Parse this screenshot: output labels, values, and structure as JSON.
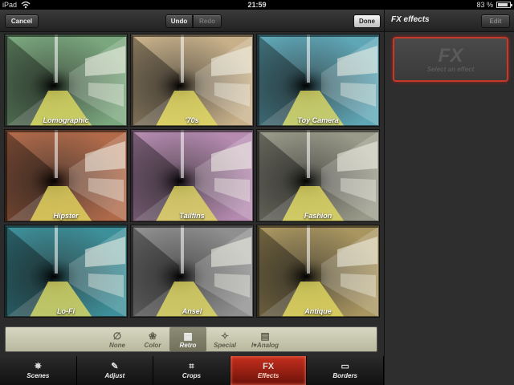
{
  "status_bar": {
    "device": "iPad",
    "time": "21:59",
    "battery_label": "83 %",
    "battery_level": 0.83,
    "wifi_icon": "wifi-icon"
  },
  "toolbar": {
    "cancel_label": "Cancel",
    "undo_label": "Undo",
    "redo_label": "Redo",
    "done_label": "Done"
  },
  "effects": [
    {
      "label": "Lomographic",
      "tint": "#7aa77d"
    },
    {
      "label": "'70s",
      "tint": "#c8b18a"
    },
    {
      "label": "Toy Camera",
      "tint": "#5fa6b6"
    },
    {
      "label": "Hipster",
      "tint": "#b06a4a"
    },
    {
      "label": "Tailfins",
      "tint": "#b58bb0"
    },
    {
      "label": "Fashion",
      "tint": "#9a9a8a"
    },
    {
      "label": "Lo-Fi",
      "tint": "#3d8f99"
    },
    {
      "label": "Ansel",
      "tint": "#8f8f8f"
    },
    {
      "label": "Antique",
      "tint": "#a99560"
    }
  ],
  "categories": [
    {
      "label": "None",
      "icon": "∅",
      "icon_name": "none-icon",
      "active": false
    },
    {
      "label": "Color",
      "icon": "❀",
      "icon_name": "color-icon",
      "active": false
    },
    {
      "label": "Retro",
      "icon": "▦",
      "icon_name": "retro-icon",
      "active": true
    },
    {
      "label": "Special",
      "icon": "✧",
      "icon_name": "special-icon",
      "active": false
    },
    {
      "label": "I♥Analog",
      "icon": "▤",
      "icon_name": "analog-icon",
      "active": false
    }
  ],
  "tabs": [
    {
      "label": "Scenes",
      "icon": "✵",
      "icon_name": "scenes-icon",
      "active": false
    },
    {
      "label": "Adjust",
      "icon": "✎",
      "icon_name": "adjust-icon",
      "active": false
    },
    {
      "label": "Crops",
      "icon": "⌗",
      "icon_name": "crops-icon",
      "active": false
    },
    {
      "label": "Effects",
      "icon": "FX",
      "icon_name": "fx-icon",
      "active": true
    },
    {
      "label": "Borders",
      "icon": "▭",
      "icon_name": "borders-icon",
      "active": false
    }
  ],
  "side_panel": {
    "title": "FX effects",
    "edit_label": "Edit",
    "card_title": "FX",
    "card_subtitle": "Select an effect"
  },
  "colors": {
    "accent": "#c33a26",
    "strip": "#c8c8b0",
    "active_tab": "#c72f1e"
  }
}
